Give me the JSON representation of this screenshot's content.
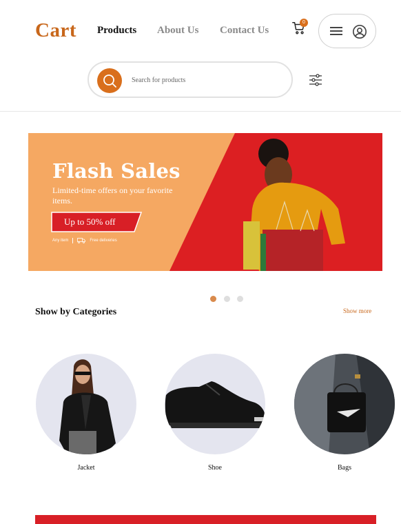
{
  "header": {
    "logo": "Cart",
    "nav": [
      {
        "label": "Products",
        "active": true
      },
      {
        "label": "About Us",
        "active": false
      },
      {
        "label": "Contact Us",
        "active": false
      }
    ],
    "cart_count": "0"
  },
  "search": {
    "placeholder": "Search for products"
  },
  "banner": {
    "title": "Flash Sales",
    "subtitle": "Limited-time offers on your favorite items.",
    "cta": "Up to 50% off",
    "meta_left": "Any item",
    "meta_right": "Free deliveries"
  },
  "carousel": {
    "count": 3,
    "active": 0
  },
  "categories": {
    "title": "Show by Categories",
    "show_more": "Show more",
    "items": [
      {
        "label": "Jacket",
        "icon": "jacket-image"
      },
      {
        "label": "Shoe",
        "icon": "shoe-image"
      },
      {
        "label": "Bags",
        "icon": "bag-image"
      }
    ]
  },
  "colors": {
    "brand": "#c8671b",
    "accent": "#d96f1c",
    "banner_orange": "#f5a862",
    "banner_red": "#dc1f22"
  }
}
